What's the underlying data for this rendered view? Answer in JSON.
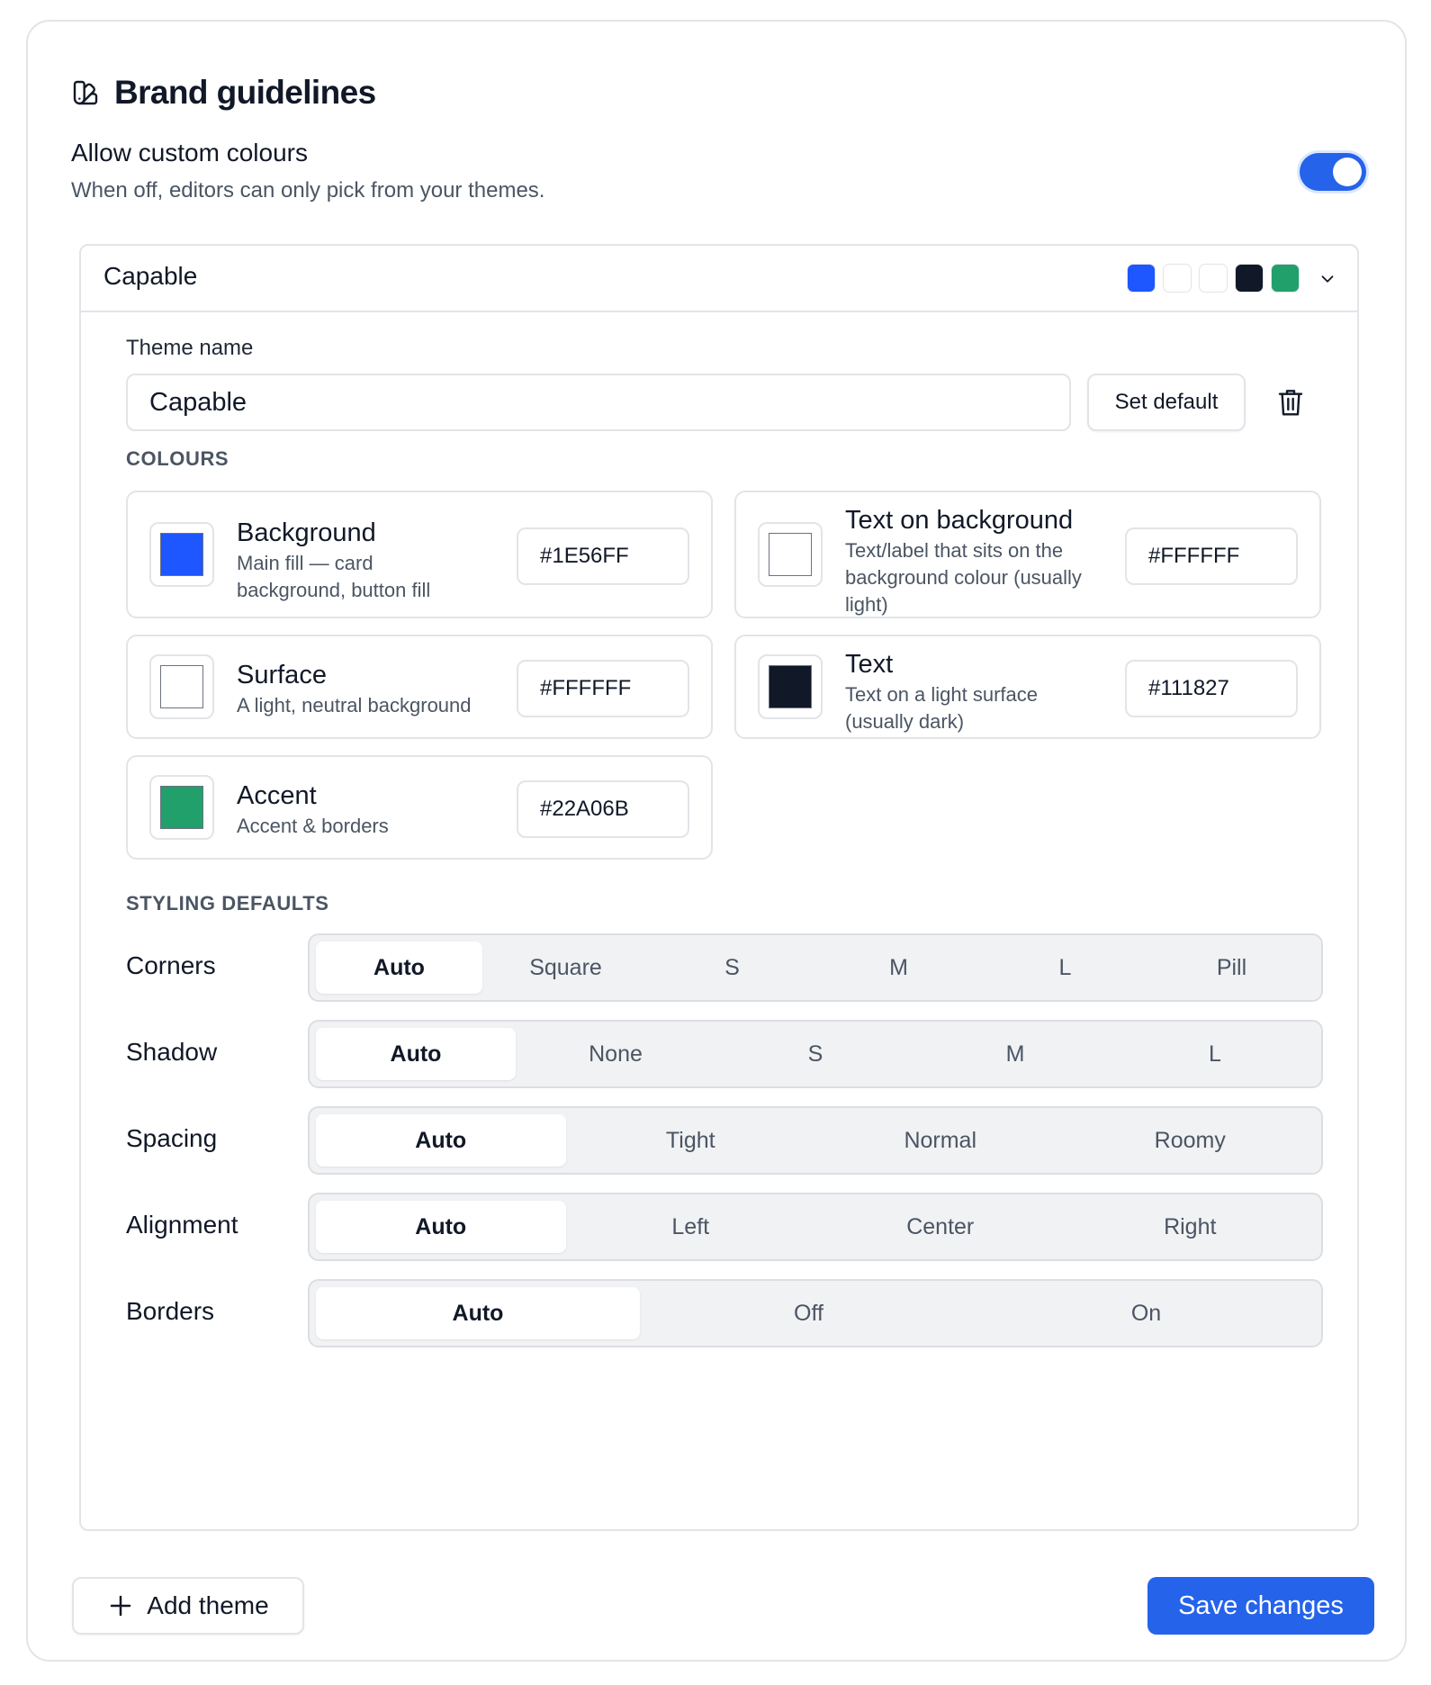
{
  "header": {
    "title": "Brand guidelines",
    "icon": "swatch-book-icon"
  },
  "allow_custom": {
    "label": "Allow custom colours",
    "description": "When off, editors can only pick from your themes.",
    "enabled": true
  },
  "theme": {
    "name": "Capable",
    "swatches": [
      "#1E56FF",
      "#FFFFFF",
      "#FFFFFF",
      "#111827",
      "#22A06B"
    ],
    "field_label": "Theme name",
    "name_value": "Capable",
    "set_default_label": "Set default",
    "colours_title": "COLOURS",
    "colours": [
      {
        "name": "Background",
        "description": "Main fill — card background, button fill",
        "hex": "#1E56FF"
      },
      {
        "name": "Text on background",
        "description": "Text/label that sits on the background colour (usually light)",
        "hex": "#FFFFFF"
      },
      {
        "name": "Surface",
        "description": "A light, neutral background",
        "hex": "#FFFFFF"
      },
      {
        "name": "Text",
        "description": "Text on a light surface (usually dark)",
        "hex": "#111827"
      },
      {
        "name": "Accent",
        "description": "Accent & borders",
        "hex": "#22A06B"
      }
    ],
    "styling_title": "STYLING DEFAULTS",
    "styling": [
      {
        "label": "Corners",
        "options": [
          "Auto",
          "Square",
          "S",
          "M",
          "L",
          "Pill"
        ],
        "selected": "Auto"
      },
      {
        "label": "Shadow",
        "options": [
          "Auto",
          "None",
          "S",
          "M",
          "L"
        ],
        "selected": "Auto"
      },
      {
        "label": "Spacing",
        "options": [
          "Auto",
          "Tight",
          "Normal",
          "Roomy"
        ],
        "selected": "Auto"
      },
      {
        "label": "Alignment",
        "options": [
          "Auto",
          "Left",
          "Center",
          "Right"
        ],
        "selected": "Auto"
      },
      {
        "label": "Borders",
        "options": [
          "Auto",
          "Off",
          "On"
        ],
        "selected": "Auto"
      }
    ]
  },
  "footer": {
    "add_theme_label": "Add theme",
    "save_label": "Save changes"
  },
  "colors": {
    "accent": "#2563EB",
    "border": "#E2E4E8"
  }
}
